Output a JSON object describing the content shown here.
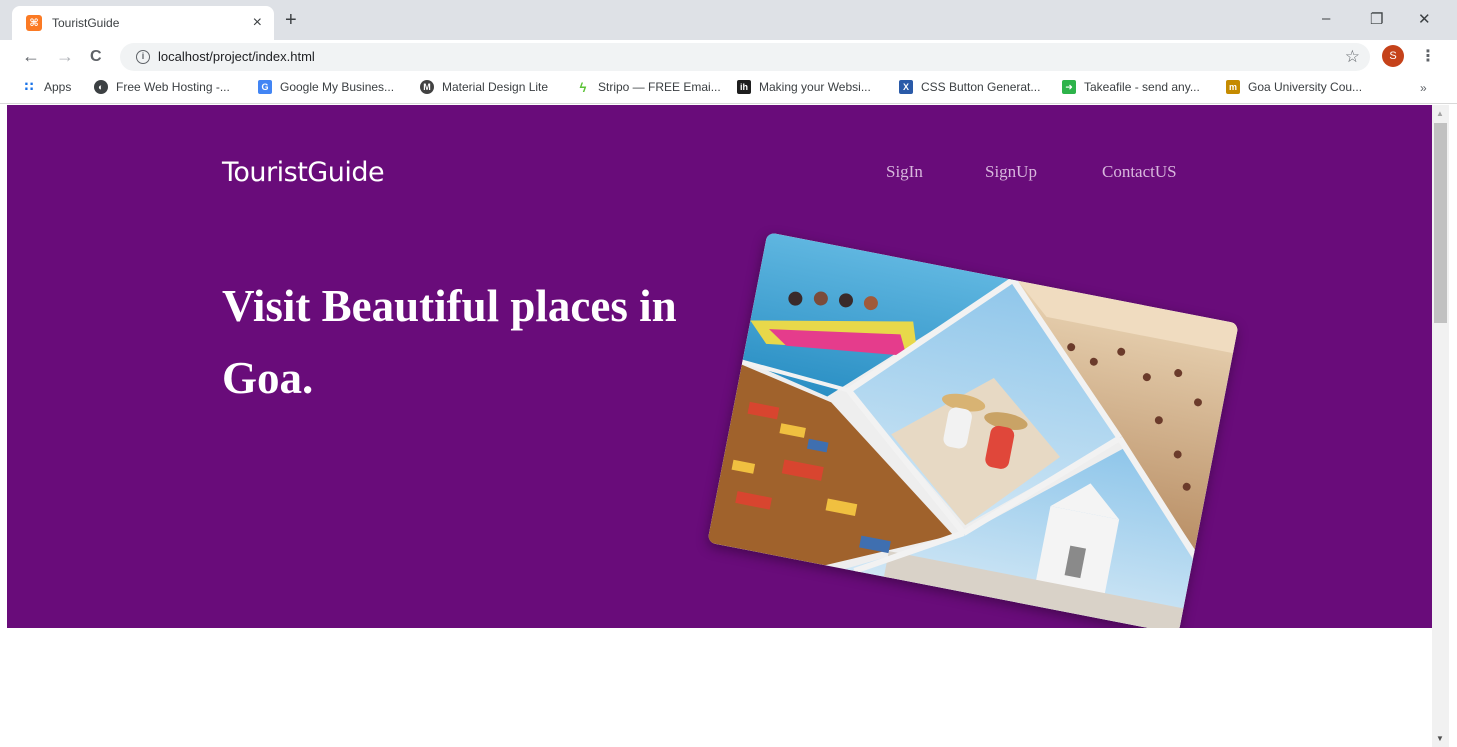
{
  "browser": {
    "tab": {
      "title": "TouristGuide",
      "close": "×",
      "favicon": "xampp-icon"
    },
    "new_tab": "+",
    "window_controls": {
      "minimize": "–",
      "restore": "❐",
      "close": "✕"
    },
    "toolbar": {
      "back": "←",
      "forward": "→",
      "reload": "C",
      "url": "localhost/project/index.html",
      "star": "☆",
      "avatar_initial": "S",
      "menu": "⋮"
    },
    "bookmarks": [
      {
        "label": "Apps",
        "icon": "apps-grid-icon",
        "color": "#1a73e8"
      },
      {
        "label": "Free Web Hosting -...",
        "icon": "globe-icon",
        "color": "#3c4043"
      },
      {
        "label": "Google My Busines...",
        "icon": "google-business-icon",
        "color": "#4285f4"
      },
      {
        "label": "Material Design Lite",
        "icon": "material-icon",
        "color": "#424242"
      },
      {
        "label": "Stripo — FREE Emai...",
        "icon": "stripo-icon",
        "color": "#5bc236"
      },
      {
        "label": "Making your Websi...",
        "icon": "ih-icon",
        "color": "#1e1e1e"
      },
      {
        "label": "CSS Button Generat...",
        "icon": "css-x-icon",
        "color": "#2a5aa8"
      },
      {
        "label": "Takeafile - send any...",
        "icon": "takeafile-icon",
        "color": "#2db34a"
      },
      {
        "label": "Goa University Cou...",
        "icon": "goa-university-icon",
        "color": "#c58b00"
      }
    ],
    "bookmarks_more": "»"
  },
  "page": {
    "brand": "TouristGuide",
    "nav": [
      {
        "label": "SigIn"
      },
      {
        "label": "SignUp"
      },
      {
        "label": "ContactUS"
      }
    ],
    "headline": "Visit Beautiful places in Goa.",
    "hero_color": "#690c7a",
    "hero_image": "goa-collage-image"
  }
}
